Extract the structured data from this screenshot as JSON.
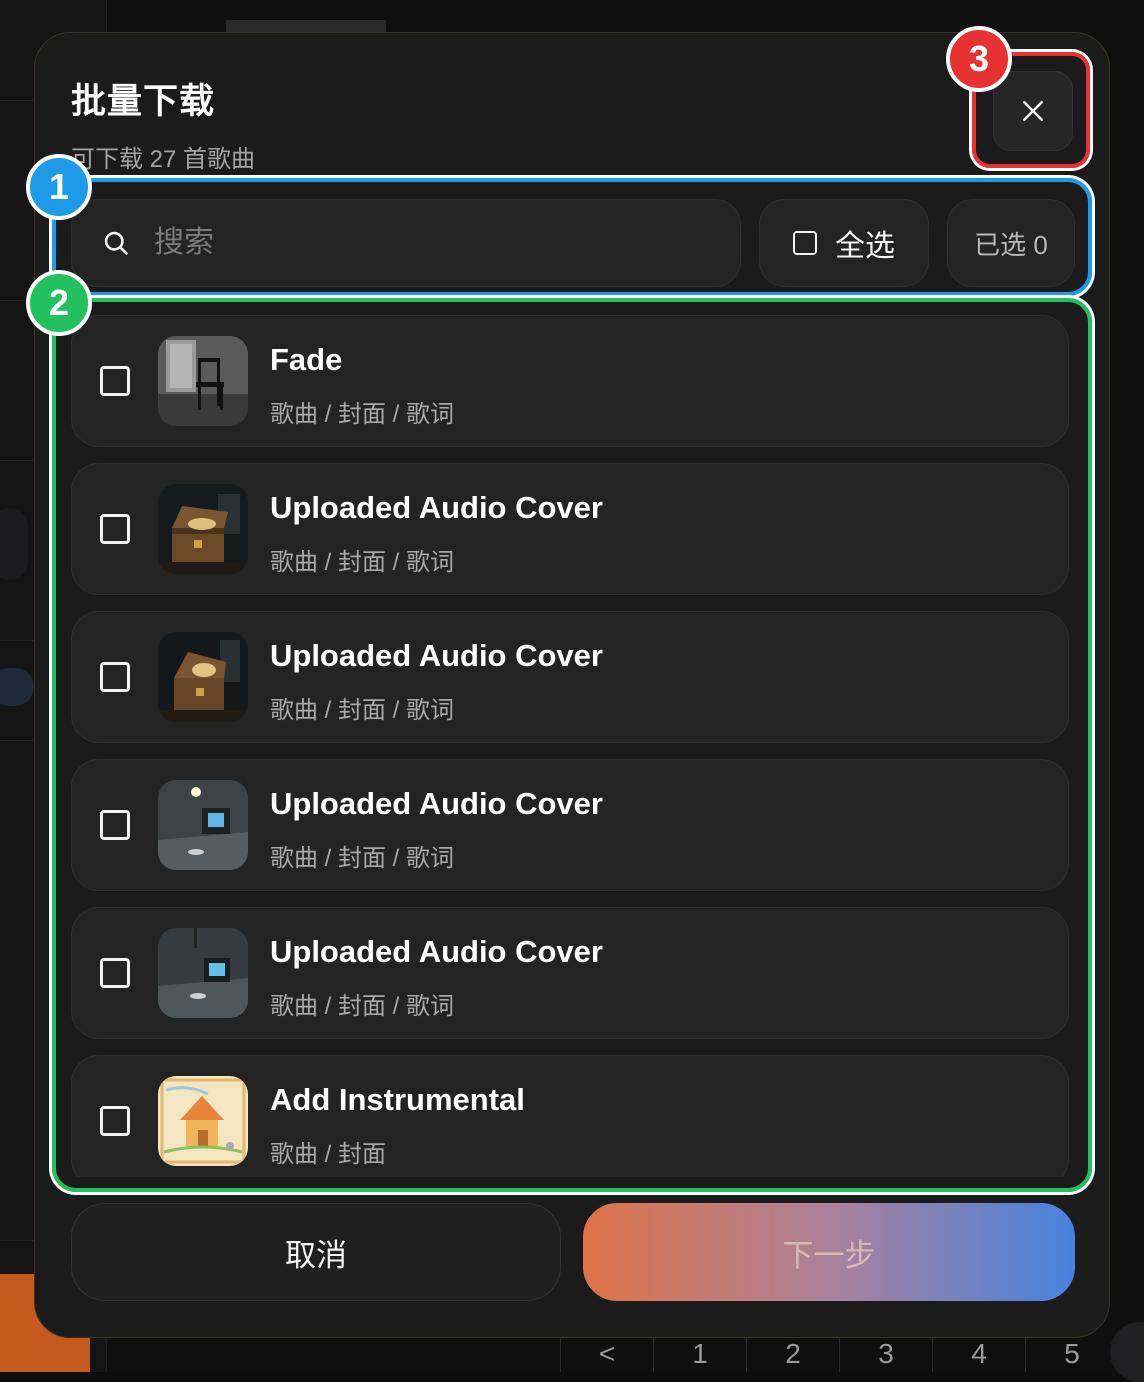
{
  "modal": {
    "title": "批量下载",
    "subtitle": "可下载 27 首歌曲",
    "close_icon": "close-icon"
  },
  "search": {
    "placeholder": "搜索",
    "icon": "search-icon"
  },
  "select_all": {
    "label": "全选"
  },
  "selected_count": "已选 0",
  "songs": [
    {
      "name": "Fade",
      "meta": "歌曲 / 封面 / 歌词",
      "thumb": "chair-in-room"
    },
    {
      "name": "Uploaded Audio Cover",
      "meta": "歌曲 / 封面 / 歌词",
      "thumb": "treasure-chest"
    },
    {
      "name": "Uploaded Audio Cover",
      "meta": "歌曲 / 封面 / 歌词",
      "thumb": "treasure-chest"
    },
    {
      "name": "Uploaded Audio Cover",
      "meta": "歌曲 / 封面 / 歌词",
      "thumb": "tv-in-room"
    },
    {
      "name": "Uploaded Audio Cover",
      "meta": "歌曲 / 封面 / 歌词",
      "thumb": "tv-in-room"
    },
    {
      "name": "Add Instrumental",
      "meta": "歌曲 / 封面",
      "thumb": "crayon-house"
    }
  ],
  "footer": {
    "cancel_label": "取消",
    "next_label": "下一步"
  },
  "background": {
    "pagination": [
      "<",
      "1",
      "2",
      "3",
      "4",
      "5"
    ]
  },
  "annotations": [
    {
      "number": "1",
      "color": "#1d9be8"
    },
    {
      "number": "2",
      "color": "#22c05e"
    },
    {
      "number": "3",
      "color": "#e83232"
    }
  ]
}
